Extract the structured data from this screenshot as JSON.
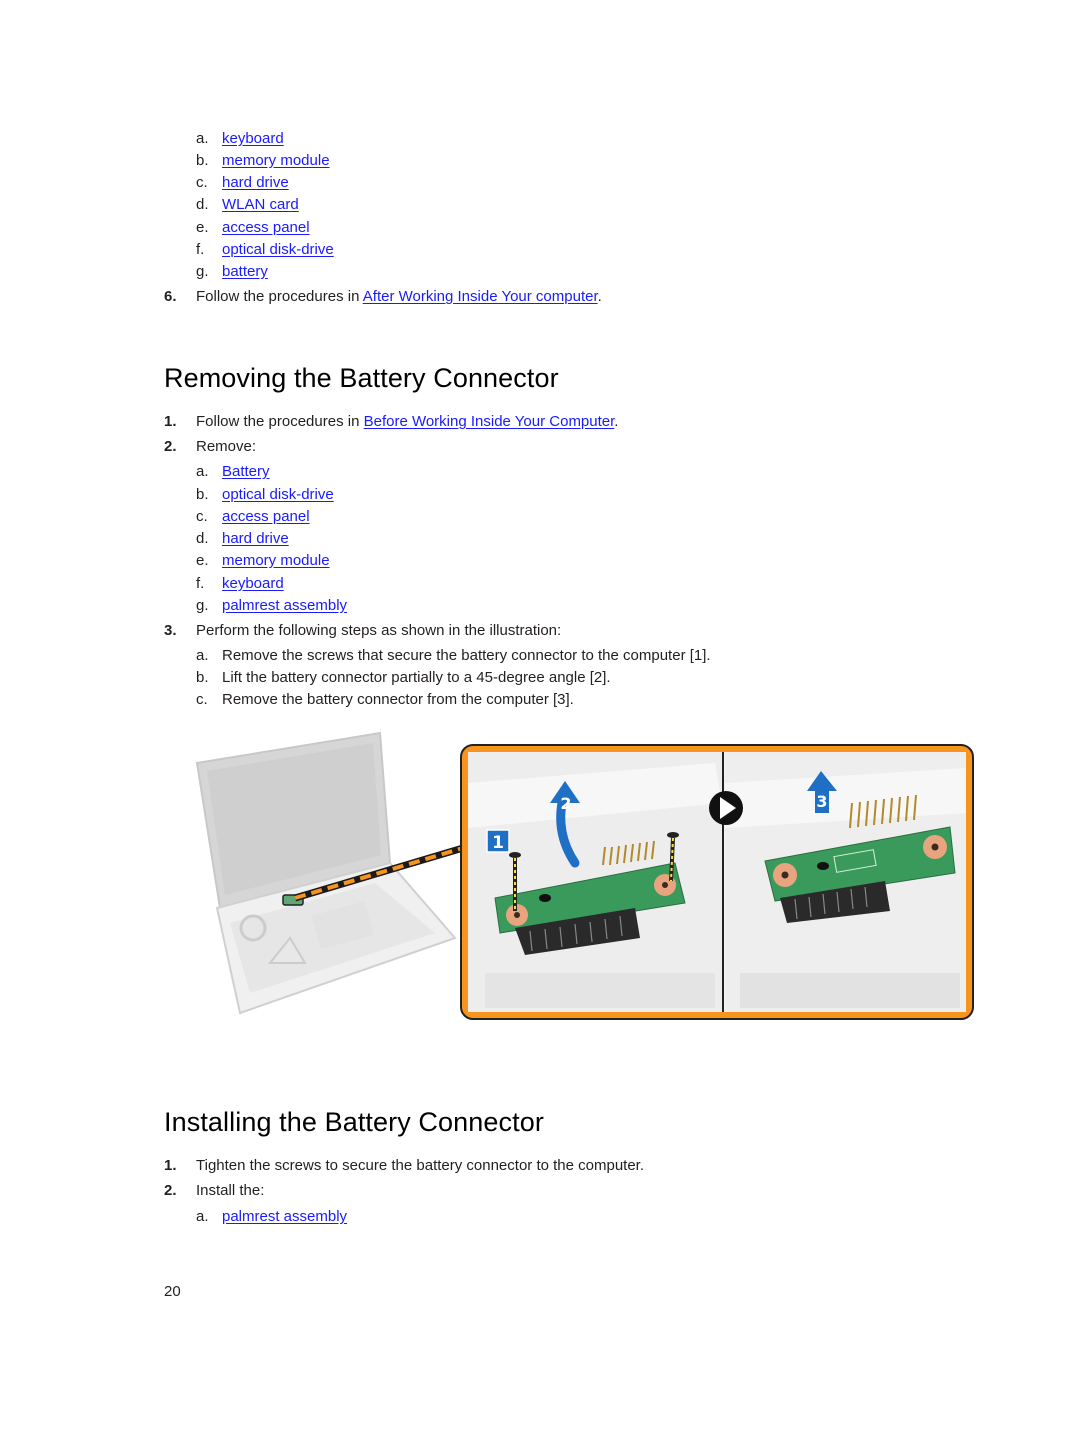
{
  "colors": {
    "link": "#1a1aff",
    "text": "#231f20",
    "callout_orange": "#f7941d",
    "arrow_blue": "#1f6fc5",
    "pcb_green": "#3a9a5b"
  },
  "top_list": {
    "items": [
      {
        "letter": "a.",
        "label": "keyboard"
      },
      {
        "letter": "b.",
        "label": "memory module"
      },
      {
        "letter": "c.",
        "label": "hard drive"
      },
      {
        "letter": "d.",
        "label": "WLAN card"
      },
      {
        "letter": "e.",
        "label": "access panel"
      },
      {
        "letter": "f.",
        "label": "optical disk-drive"
      },
      {
        "letter": "g.",
        "label": "battery"
      }
    ],
    "step6": {
      "num": "6.",
      "text": "Follow the procedures in ",
      "link": "After Working Inside Your computer",
      "after": "."
    }
  },
  "removing": {
    "title": "Removing the Battery Connector",
    "step1": {
      "num": "1.",
      "text": "Follow the procedures in ",
      "link": "Before Working Inside Your Computer",
      "after": "."
    },
    "step2": {
      "num": "2.",
      "text": "Remove:"
    },
    "remove_items": [
      {
        "letter": "a.",
        "label": "Battery"
      },
      {
        "letter": "b.",
        "label": "optical disk-drive"
      },
      {
        "letter": "c.",
        "label": "access panel"
      },
      {
        "letter": "d.",
        "label": "hard drive"
      },
      {
        "letter": "e.",
        "label": "memory module"
      },
      {
        "letter": "f.",
        "label": "keyboard"
      },
      {
        "letter": "g.",
        "label": "palmrest assembly"
      }
    ],
    "step3": {
      "num": "3.",
      "text": "Perform the following steps as shown in the illustration:"
    },
    "sub_steps": [
      {
        "letter": "a.",
        "text": "Remove the screws that secure the battery connector to the computer [1]."
      },
      {
        "letter": "b.",
        "text": "Lift the battery connector partially to a 45-degree angle [2]."
      },
      {
        "letter": "c.",
        "text": "Remove the battery connector from the computer [3]."
      }
    ],
    "figure": {
      "callouts": [
        "1",
        "2",
        "3"
      ],
      "icons": [
        "laptop-illustration",
        "play-arrow-icon",
        "screw-icon",
        "lift-arrow-icon"
      ]
    }
  },
  "installing": {
    "title": "Installing the Battery Connector",
    "step1": {
      "num": "1.",
      "text": "Tighten the screws to secure the battery connector to the computer."
    },
    "step2": {
      "num": "2.",
      "text": "Install the:"
    },
    "install_items": [
      {
        "letter": "a.",
        "label": "palmrest assembly"
      }
    ]
  },
  "page_number": "20"
}
